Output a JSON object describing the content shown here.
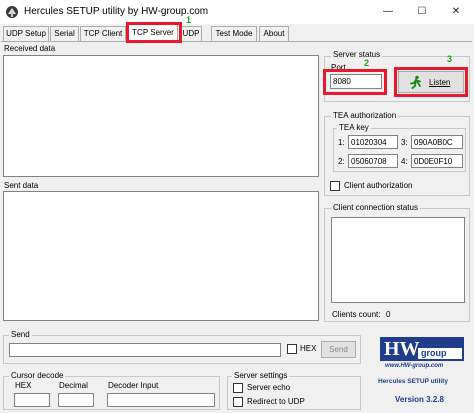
{
  "window": {
    "title": "Hercules SETUP utility by HW-group.com",
    "minimize_glyph": "—",
    "maximize_glyph": "☐",
    "close_glyph": "✕"
  },
  "tabs": [
    {
      "label": "UDP Setup"
    },
    {
      "label": "Serial"
    },
    {
      "label": "TCP Client"
    },
    {
      "label": "TCP Server"
    },
    {
      "label": "UDP"
    },
    {
      "label": "Test Mode"
    },
    {
      "label": "About"
    }
  ],
  "received": {
    "label": "Received data"
  },
  "sent": {
    "label": "Sent data"
  },
  "server_status": {
    "title": "Server status",
    "port_label": "Port",
    "port_value": "8080",
    "listen_label": "Listen"
  },
  "tea": {
    "title": "TEA authorization",
    "key_title": "TEA key",
    "keys": [
      {
        "index": "1:",
        "value": "01020304"
      },
      {
        "index": "2:",
        "value": "05060708"
      },
      {
        "index": "3:",
        "value": "090A0B0C"
      },
      {
        "index": "4:",
        "value": "0D0E0F10"
      }
    ],
    "client_auth_label": "Client authorization"
  },
  "client_status": {
    "title": "Client connection status",
    "clients_count_label": "Clients count:",
    "clients_count_value": "0"
  },
  "send": {
    "title": "Send",
    "hex_label": "HEX",
    "send_button": "Send",
    "input_value": ""
  },
  "cursor_decode": {
    "title": "Cursor decode",
    "hex_label": "HEX",
    "decimal_label": "Decimal",
    "decoder_label": "Decoder Input"
  },
  "server_settings": {
    "title": "Server settings",
    "server_echo_label": "Server echo",
    "redirect_label": "Redirect to UDP"
  },
  "logo": {
    "brand_hw": "HW",
    "brand_group": "group",
    "url": "www.HW-group.com",
    "product": "Hercules SETUP utility",
    "version_label": "Version",
    "version_value": "3.2.8"
  },
  "annotations": {
    "marker_1": "1",
    "marker_2": "2",
    "marker_3": "3",
    "highlight_color": "#e8192c",
    "marker_color": "#1aa31a"
  }
}
